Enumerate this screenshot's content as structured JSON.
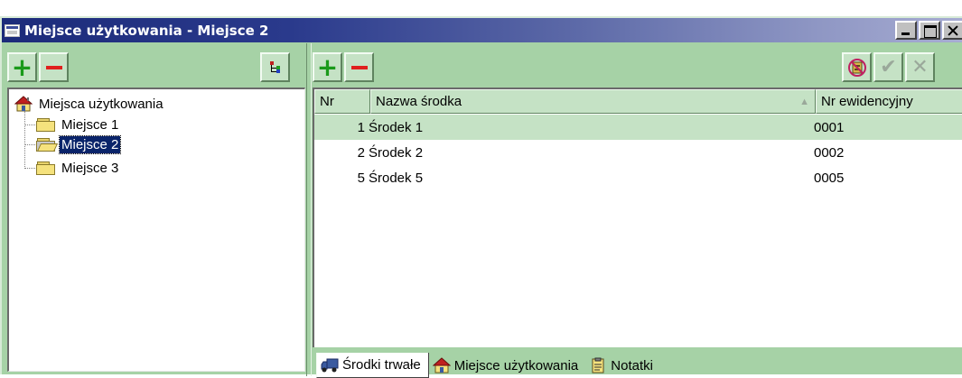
{
  "window": {
    "title": "Miejsce użytkowania - Miejsce 2"
  },
  "left_toolbar": {
    "add_icon": "plus-icon",
    "remove_icon": "minus-icon",
    "tree_view_icon": "tree-structure-icon"
  },
  "tree": {
    "root_label": "Miejsca użytkowania",
    "root_icon": "house-icon",
    "items": [
      {
        "label": "Miejsce 1",
        "icon": "folder-icon",
        "selected": false
      },
      {
        "label": "Miejsce 2",
        "icon": "folder-open-icon",
        "selected": true
      },
      {
        "label": "Miejsce 3",
        "icon": "folder-icon",
        "selected": false
      }
    ]
  },
  "right_toolbar": {
    "add_icon": "plus-icon",
    "remove_icon": "minus-icon",
    "tool_icon": "no-entry-icon",
    "confirm_icon": "check-icon",
    "cancel_icon": "x-icon"
  },
  "grid": {
    "columns": [
      "Nr",
      "Nazwa środka",
      "Nr ewidencyjny"
    ],
    "rows": [
      {
        "nr": "1",
        "name": "Środek 1",
        "ev": "0001",
        "selected": true
      },
      {
        "nr": "2",
        "name": "Środek 2",
        "ev": "0002",
        "selected": false
      },
      {
        "nr": "5",
        "name": "Środek 5",
        "ev": "0005",
        "selected": false
      }
    ]
  },
  "tabs": [
    {
      "label": "Środki trwałe",
      "icon": "truck-icon",
      "active": true
    },
    {
      "label": "Miejsce użytkowania",
      "icon": "house-icon",
      "active": false
    },
    {
      "label": "Notatki",
      "icon": "clipboard-icon",
      "active": false
    }
  ],
  "colors": {
    "panel": "#a6d2a6",
    "selection": "#0a246a",
    "row_highlight": "#c5e2c5"
  }
}
